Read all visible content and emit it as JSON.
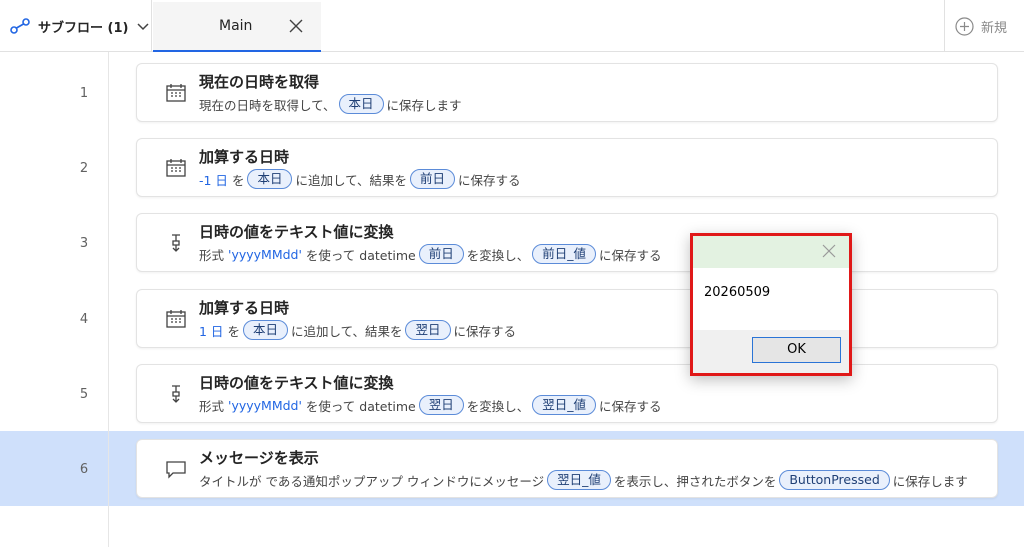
{
  "header": {
    "subflow_label": "サブフロー (1)",
    "tab_main": "Main",
    "new_label": "新規"
  },
  "rows": [
    {
      "num": "1",
      "title": "現在の日時を取得",
      "desc": {
        "t1": "現在の日時を取得して、",
        "p1": "本日",
        "t2": "に保存します"
      }
    },
    {
      "num": "2",
      "title": "加算する日時",
      "desc": {
        "v1": "-1 日",
        "t1": "を",
        "p1": "本日",
        "t2": "に追加して、結果を",
        "p2": "前日",
        "t3": "に保存する"
      }
    },
    {
      "num": "3",
      "title": "日時の値をテキスト値に変換",
      "desc": {
        "t1": "形式",
        "v1": "'yyyyMMdd'",
        "t2": "を使って datetime",
        "p1": "前日",
        "t3": "を変換し、",
        "p2": "前日_値",
        "t4": "に保存する"
      }
    },
    {
      "num": "4",
      "title": "加算する日時",
      "desc": {
        "v1": "1 日",
        "t1": "を",
        "p1": "本日",
        "t2": "に追加して、結果を",
        "p2": "翌日",
        "t3": "に保存する"
      }
    },
    {
      "num": "5",
      "title": "日時の値をテキスト値に変換",
      "desc": {
        "t1": "形式",
        "v1": "'yyyyMMdd'",
        "t2": "を使って datetime",
        "p1": "翌日",
        "t3": "を変換し、",
        "p2": "翌日_値",
        "t4": "に保存する"
      }
    },
    {
      "num": "6",
      "title": "メッセージを表示",
      "desc": {
        "t1": "タイトルが  である通知ポップアップ ウィンドウにメッセージ",
        "p1": "翌日_値",
        "t2": "を表示し、押されたボタンを",
        "p2": "ButtonPressed",
        "t3": "に保存します"
      }
    }
  ],
  "popup": {
    "message": "20260509",
    "ok_label": "OK"
  },
  "colors": {
    "accent": "#2266e3",
    "selected_row": "#cfe0fb",
    "popup_border": "#e01818",
    "popup_title_bg": "#e3f2e1"
  }
}
